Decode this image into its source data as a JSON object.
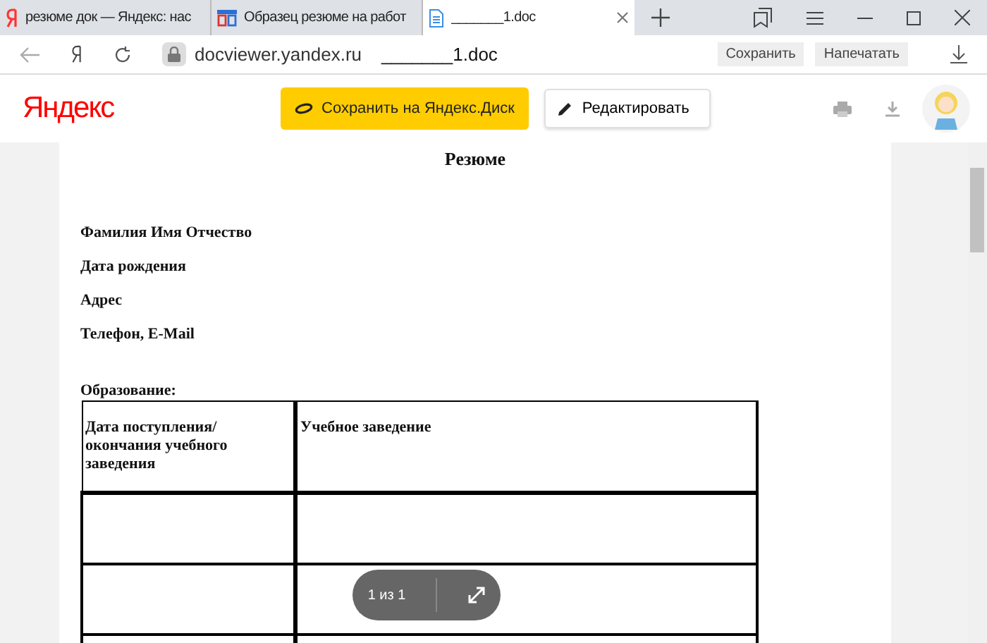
{
  "tabs": [
    {
      "title": "резюме док — Яндекс: нас",
      "kind": "yandex",
      "selected": false
    },
    {
      "title": "Образец резюме на работ",
      "kind": "site",
      "selected": false
    },
    {
      "title": "_______1.doc",
      "kind": "doc",
      "selected": true
    }
  ],
  "address_bar": {
    "host": "docviewer.yandex.ru",
    "path": "_______1.doc",
    "buttons": [
      "Сохранить",
      "Напечатать"
    ]
  },
  "header": {
    "logo": "Яндекс",
    "save_button": "Сохранить на Яндекс.Диск",
    "edit_button": "Редактировать"
  },
  "document": {
    "title": "Резюме",
    "fields": [
      "Фамилия Имя Отчество",
      "Дата рождения",
      "Адрес",
      "Телефон, E-Mail"
    ],
    "section": "Образование:",
    "table": {
      "columns": [
        "Дата поступления/ окончания учебного заведения",
        "Учебное заведение"
      ],
      "rows": [
        {
          "kind": "blank"
        },
        {
          "kind": "blank"
        },
        {
          "kind": "blank"
        }
      ]
    }
  },
  "pager": {
    "label": "1 из 1"
  }
}
